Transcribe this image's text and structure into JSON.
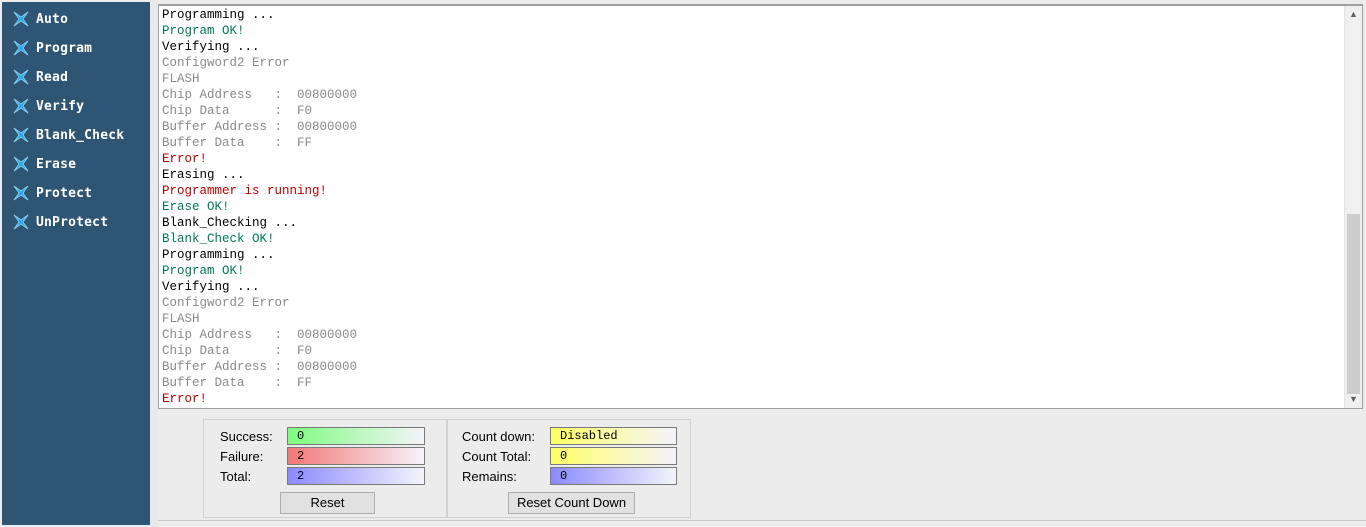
{
  "sidebar": {
    "items": [
      {
        "label": "Auto",
        "icon": "x-cross-icon"
      },
      {
        "label": "Program",
        "icon": "x-cross-icon"
      },
      {
        "label": "Read",
        "icon": "x-cross-icon"
      },
      {
        "label": "Verify",
        "icon": "x-cross-icon"
      },
      {
        "label": "Blank_Check",
        "icon": "x-cross-icon"
      },
      {
        "label": "Erase",
        "icon": "x-cross-icon"
      },
      {
        "label": "Protect",
        "icon": "x-cross-icon"
      },
      {
        "label": "UnProtect",
        "icon": "x-cross-icon"
      }
    ],
    "background": "#2e5573",
    "icon_color": "#2aa7e0"
  },
  "log": {
    "lines": [
      {
        "text": "Programming ...",
        "color": "black"
      },
      {
        "text": "Program OK!",
        "color": "green"
      },
      {
        "text": "Verifying ...",
        "color": "black"
      },
      {
        "text": "Configword2 Error",
        "color": "gray"
      },
      {
        "text": "FLASH",
        "color": "gray"
      },
      {
        "text": "Chip Address   :  00800000",
        "color": "gray"
      },
      {
        "text": "Chip Data      :  F0",
        "color": "gray"
      },
      {
        "text": "Buffer Address :  00800000",
        "color": "gray"
      },
      {
        "text": "Buffer Data    :  FF",
        "color": "gray"
      },
      {
        "text": "Error!",
        "color": "red"
      },
      {
        "text": "Erasing ...",
        "color": "black"
      },
      {
        "text": "Programmer is running!",
        "color": "red"
      },
      {
        "text": "Erase OK!",
        "color": "green"
      },
      {
        "text": "Blank_Checking ...",
        "color": "black"
      },
      {
        "text": "Blank_Check OK!",
        "color": "green"
      },
      {
        "text": "Programming ...",
        "color": "black"
      },
      {
        "text": "Program OK!",
        "color": "green"
      },
      {
        "text": "Verifying ...",
        "color": "black"
      },
      {
        "text": "Configword2 Error",
        "color": "gray"
      },
      {
        "text": "FLASH",
        "color": "gray"
      },
      {
        "text": "Chip Address   :  00800000",
        "color": "gray"
      },
      {
        "text": "Chip Data      :  F0",
        "color": "gray"
      },
      {
        "text": "Buffer Address :  00800000",
        "color": "gray"
      },
      {
        "text": "Buffer Data    :  FF",
        "color": "gray"
      },
      {
        "text": "Error!",
        "color": "red"
      }
    ]
  },
  "stats": {
    "success_label": "Success:",
    "success_value": "0",
    "failure_label": "Failure:",
    "failure_value": "2",
    "total_label": "Total:",
    "total_value": "2",
    "reset_label": "Reset",
    "colors": {
      "success": "#7dfc7d",
      "failure": "#f47777",
      "total": "#8a8aff"
    }
  },
  "countdown": {
    "count_down_label": "Count down:",
    "count_down_value": "Disabled",
    "count_total_label": "Count Total:",
    "count_total_value": "0",
    "remains_label": "Remains:",
    "remains_value": "0",
    "reset_label": "Reset Count Down",
    "colors": {
      "count_down": "#ffff66",
      "count_total": "#ffff66",
      "remains": "#8a8aff"
    }
  }
}
